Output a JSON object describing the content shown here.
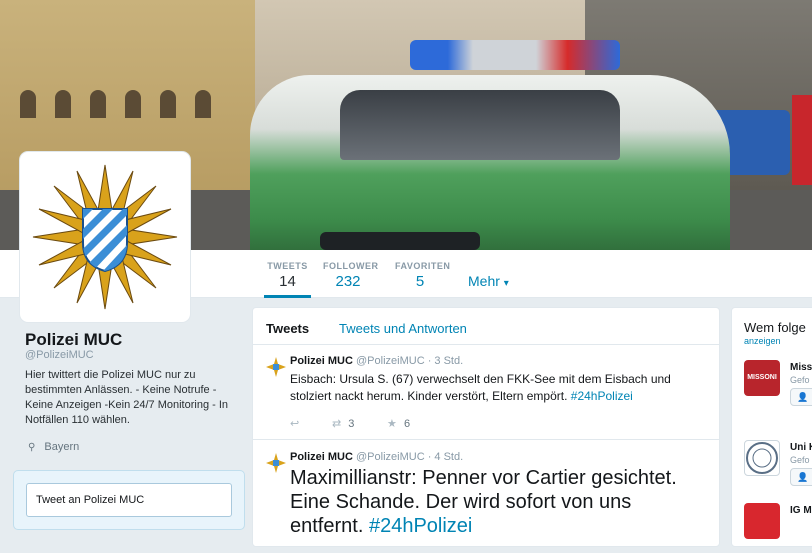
{
  "profile": {
    "name": "Polizei MUC",
    "handle": "@PolizeiMUC",
    "bio": "Hier twittert die Polizei MUC nur zu bestimmten Anlässen. - Keine Notrufe - Keine Anzeigen -Kein 24/7 Monitoring - In Notfällen 110 wählen.",
    "location": "Bayern",
    "tweet_to": "Tweet an Polizei MUC"
  },
  "stats": [
    {
      "label": "TWEETS",
      "value": "14"
    },
    {
      "label": "FOLLOWER",
      "value": "232"
    },
    {
      "label": "FAVORITEN",
      "value": "5"
    }
  ],
  "more_label": "Mehr",
  "tabs": [
    "Tweets",
    "Tweets und Antworten"
  ],
  "tweets": [
    {
      "name": "Polizei MUC",
      "handle": "@PolizeiMUC",
      "time": "· 3 Std.",
      "text": "Eisbach: Ursula S. (67) verwechselt den FKK-See mit dem Eisbach und stolziert nackt herum. Kinder verstört, Eltern empört.",
      "hashtag": "#24hPolizei",
      "retweets": "3",
      "favorites": "6"
    },
    {
      "name": "Polizei MUC",
      "handle": "@PolizeiMUC",
      "time": "· 4 Std.",
      "text": "Maximillianstr: Penner vor Cartier gesichtet. Eine Schande. Der wird sofort von uns entfernt.",
      "hashtag": "#24hPolizei"
    }
  ],
  "who_to_follow": {
    "title": "Wem folge",
    "subtitle": "anzeigen",
    "items": [
      {
        "name": "Missc",
        "handle": "Gefo",
        "logo_text": "MISSONI",
        "logo_color": "#b8252c"
      },
      {
        "name": "Uni K",
        "handle": "Gefo",
        "logo_text": "",
        "logo_color": "#ffffff"
      },
      {
        "name": "IG Me",
        "handle": "",
        "logo_text": "",
        "logo_color": "#d8272e"
      }
    ]
  },
  "colors": {
    "accent": "#0084b4",
    "badge_gold": "#d9a21b",
    "badge_blue": "#3b8ed6"
  }
}
